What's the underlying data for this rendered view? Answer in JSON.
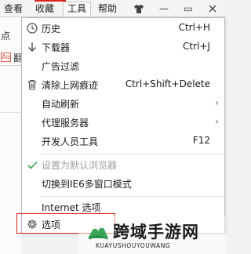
{
  "menubar": {
    "items": [
      {
        "label": "查看"
      },
      {
        "label": "收藏"
      },
      {
        "label": "工具"
      },
      {
        "label": "帮助"
      }
    ],
    "shirt_icon": "shirt-icon",
    "minimize_symbol": "—",
    "maximize_symbol": "▭"
  },
  "background": {
    "text_top": "点",
    "text_row2": "翻",
    "badge": "Aa"
  },
  "menu": {
    "items": [
      {
        "label": "历史",
        "shortcut": "Ctrl+H",
        "icon": "clock-icon"
      },
      {
        "label": "下载器",
        "shortcut": "Ctrl+J",
        "icon": "download-arrow-icon"
      },
      {
        "label": "广告过滤",
        "shortcut": ""
      },
      {
        "label": "清除上网痕迹",
        "shortcut": "Ctrl+Shift+Delete",
        "icon": "trash-icon"
      },
      {
        "label": "自动刷新",
        "submenu": true
      },
      {
        "label": "代理服务器",
        "submenu": true
      },
      {
        "label": "开发人员工具",
        "shortcut": "F12"
      },
      {
        "label": "设置为默认浏览器",
        "disabled": true,
        "checked": true,
        "icon": "checkmark-icon"
      },
      {
        "label": "切换到IE6多窗口模式"
      },
      {
        "label": "Internet 选项"
      },
      {
        "label": "选项",
        "icon": "gear-icon",
        "highlighted": true
      }
    ],
    "submenu_arrow": "›"
  },
  "watermark": {
    "title": "跨域手游网",
    "subtitle": "KUAYUSHOUYOUWANG"
  },
  "colors": {
    "accent_red": "#d9251c",
    "check_green": "#3aa655",
    "disabled_text": "#a0a0a0"
  }
}
